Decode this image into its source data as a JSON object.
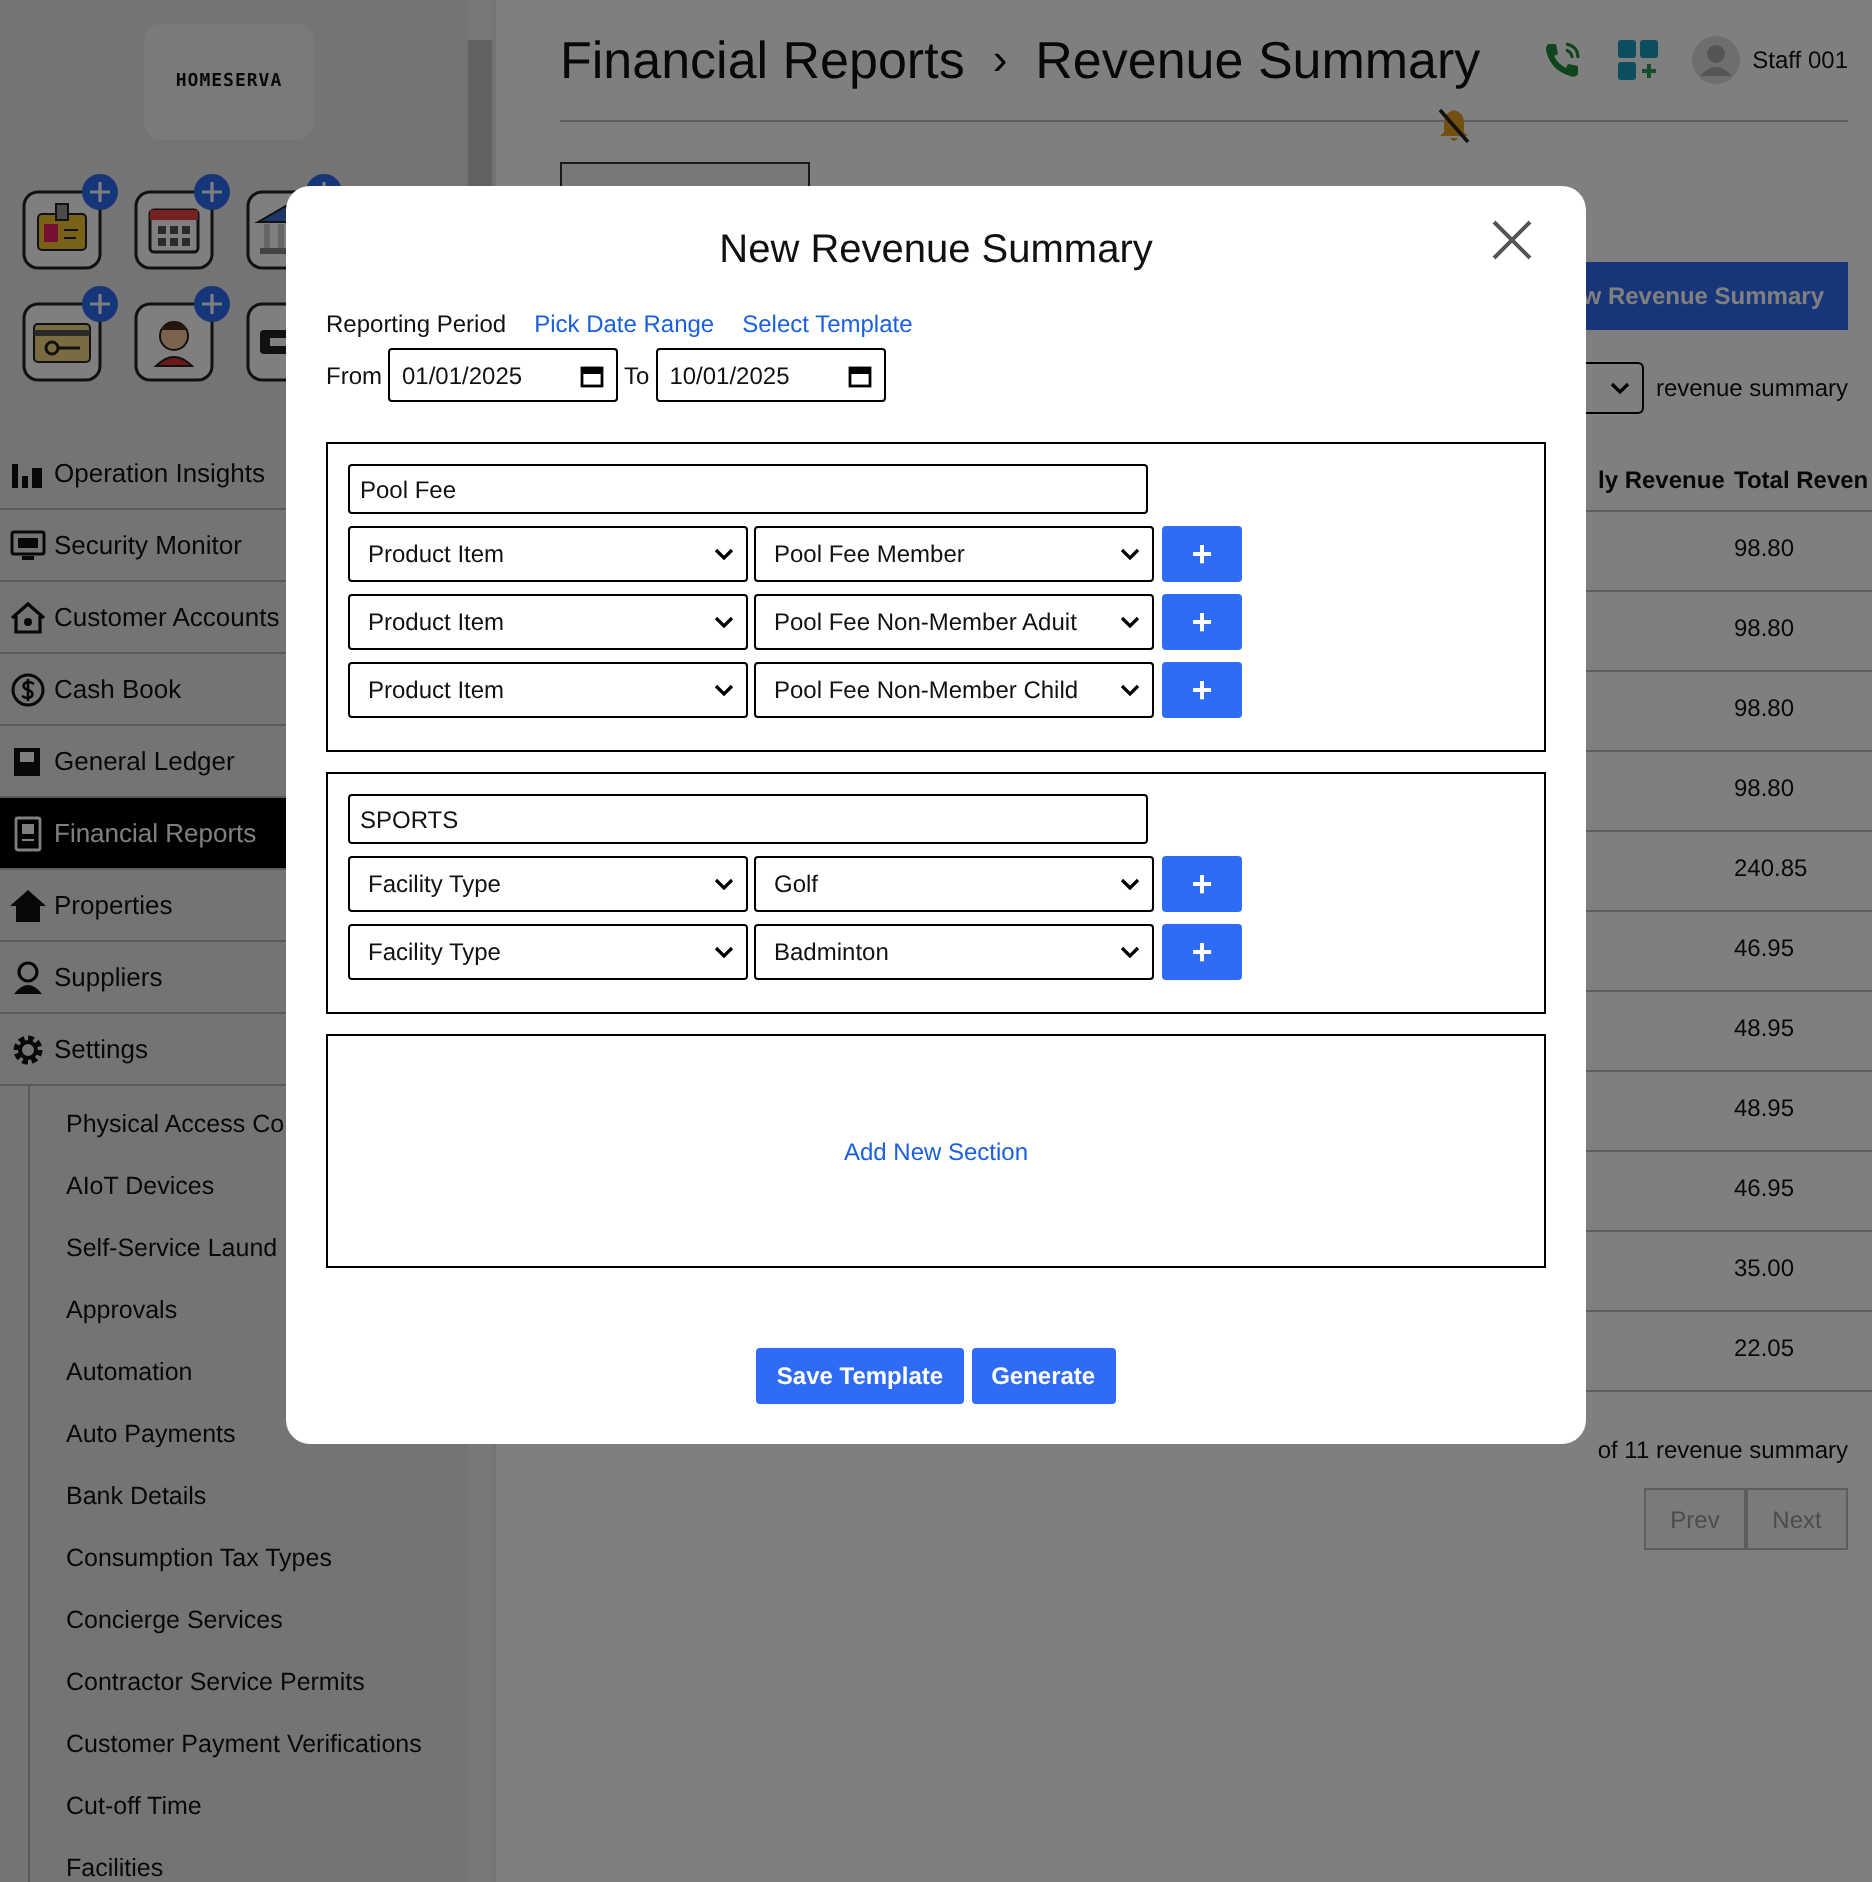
{
  "sidebar": {
    "logo": "HOMESERVA",
    "menu": [
      {
        "label": "Operation Insights",
        "selected": false
      },
      {
        "label": "Security Monitor",
        "selected": false
      },
      {
        "label": "Customer Accounts",
        "selected": false
      },
      {
        "label": "Cash Book",
        "selected": false
      },
      {
        "label": "General Ledger",
        "selected": false
      },
      {
        "label": "Financial Reports",
        "selected": true
      },
      {
        "label": "Properties",
        "selected": false
      },
      {
        "label": "Suppliers",
        "selected": false
      },
      {
        "label": "Settings",
        "selected": false,
        "expanded": true,
        "children": [
          {
            "label": "Physical Access Co"
          },
          {
            "label": "AIoT Devices"
          },
          {
            "label": "Self-Service Laund"
          },
          {
            "label": "Approvals"
          },
          {
            "label": "Automation"
          },
          {
            "label": "Auto Payments"
          },
          {
            "label": "Bank Details"
          },
          {
            "label": "Consumption Tax Types"
          },
          {
            "label": "Concierge Services"
          },
          {
            "label": "Contractor Service Permits"
          },
          {
            "label": "Customer Payment Verifications"
          },
          {
            "label": "Cut-off Time"
          },
          {
            "label": "Facilities"
          }
        ]
      }
    ]
  },
  "header": {
    "breadcrumb": [
      "Financial Reports",
      "Revenue Summary"
    ],
    "separator": "›",
    "user": "Staff 001"
  },
  "page": {
    "new_button": "w Revenue Summary",
    "filter_label": "revenue summary",
    "table": {
      "columns": [
        "ly Revenue",
        "Total Reven"
      ],
      "rows": [
        [
          "",
          "98.80"
        ],
        [
          "",
          "98.80"
        ],
        [
          "",
          "98.80"
        ],
        [
          "",
          "98.80"
        ],
        [
          "",
          "240.85"
        ],
        [
          "",
          "46.95"
        ],
        [
          "",
          "48.95"
        ],
        [
          "",
          "48.95"
        ],
        [
          "",
          "46.95"
        ],
        [
          "",
          "35.00"
        ],
        [
          "",
          "22.05"
        ]
      ]
    },
    "pagination": {
      "summary": "of 11 revenue summary",
      "buttons": [
        {
          "label": "Prev",
          "disabled": true
        },
        {
          "label": "Next",
          "disabled": true
        }
      ]
    }
  },
  "dialog": {
    "title": "New Revenue Summary",
    "period_label": "Reporting Period",
    "links": [
      "Pick Date Range",
      "Select Template"
    ],
    "from_label": "From",
    "from": "01/01/2025",
    "to_label": "To",
    "to": "10/01/2025",
    "sections": [
      {
        "name": "Pool Fee",
        "rows": [
          {
            "type": "Product Item",
            "item": "Pool Fee Member",
            "add": "+"
          },
          {
            "type": "Product Item",
            "item": "Pool Fee Non-Member Aduit",
            "add": "+"
          },
          {
            "type": "Product Item",
            "item": "Pool Fee Non-Member Child",
            "add": "+"
          }
        ]
      },
      {
        "name": "SPORTS",
        "rows": [
          {
            "type": "Facility Type",
            "item": "Golf",
            "add": "+"
          },
          {
            "type": "Facility Type",
            "item": "Badminton",
            "add": "+"
          }
        ]
      }
    ],
    "add_section": "Add New Section",
    "buttons": [
      "Save Template",
      "Generate"
    ]
  }
}
